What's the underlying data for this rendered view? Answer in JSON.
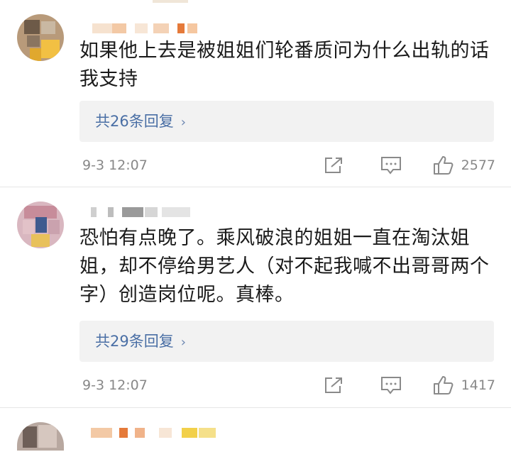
{
  "comments": [
    {
      "text": "如果他上去是被姐姐们轮番质问为什么出轨的话我支持",
      "replies_label": "共26条回复",
      "timestamp": "9-3 12:07",
      "likes": "2577",
      "icons": [
        "share-icon",
        "comment-icon",
        "like-icon"
      ]
    },
    {
      "text": "恐怕有点晚了。乘风破浪的姐姐一直在淘汰姐姐，却不停给男艺人（对不起我喊不出哥哥两个字）创造岗位呢。真棒。",
      "replies_label": "共29条回复",
      "timestamp": "9-3 12:07",
      "likes": "1417",
      "icons": [
        "share-icon",
        "comment-icon",
        "like-icon"
      ]
    }
  ],
  "chevron": "›",
  "colors": {
    "link": "#4a6fa5",
    "meta": "#888888",
    "reply_bg": "#f2f2f2"
  }
}
